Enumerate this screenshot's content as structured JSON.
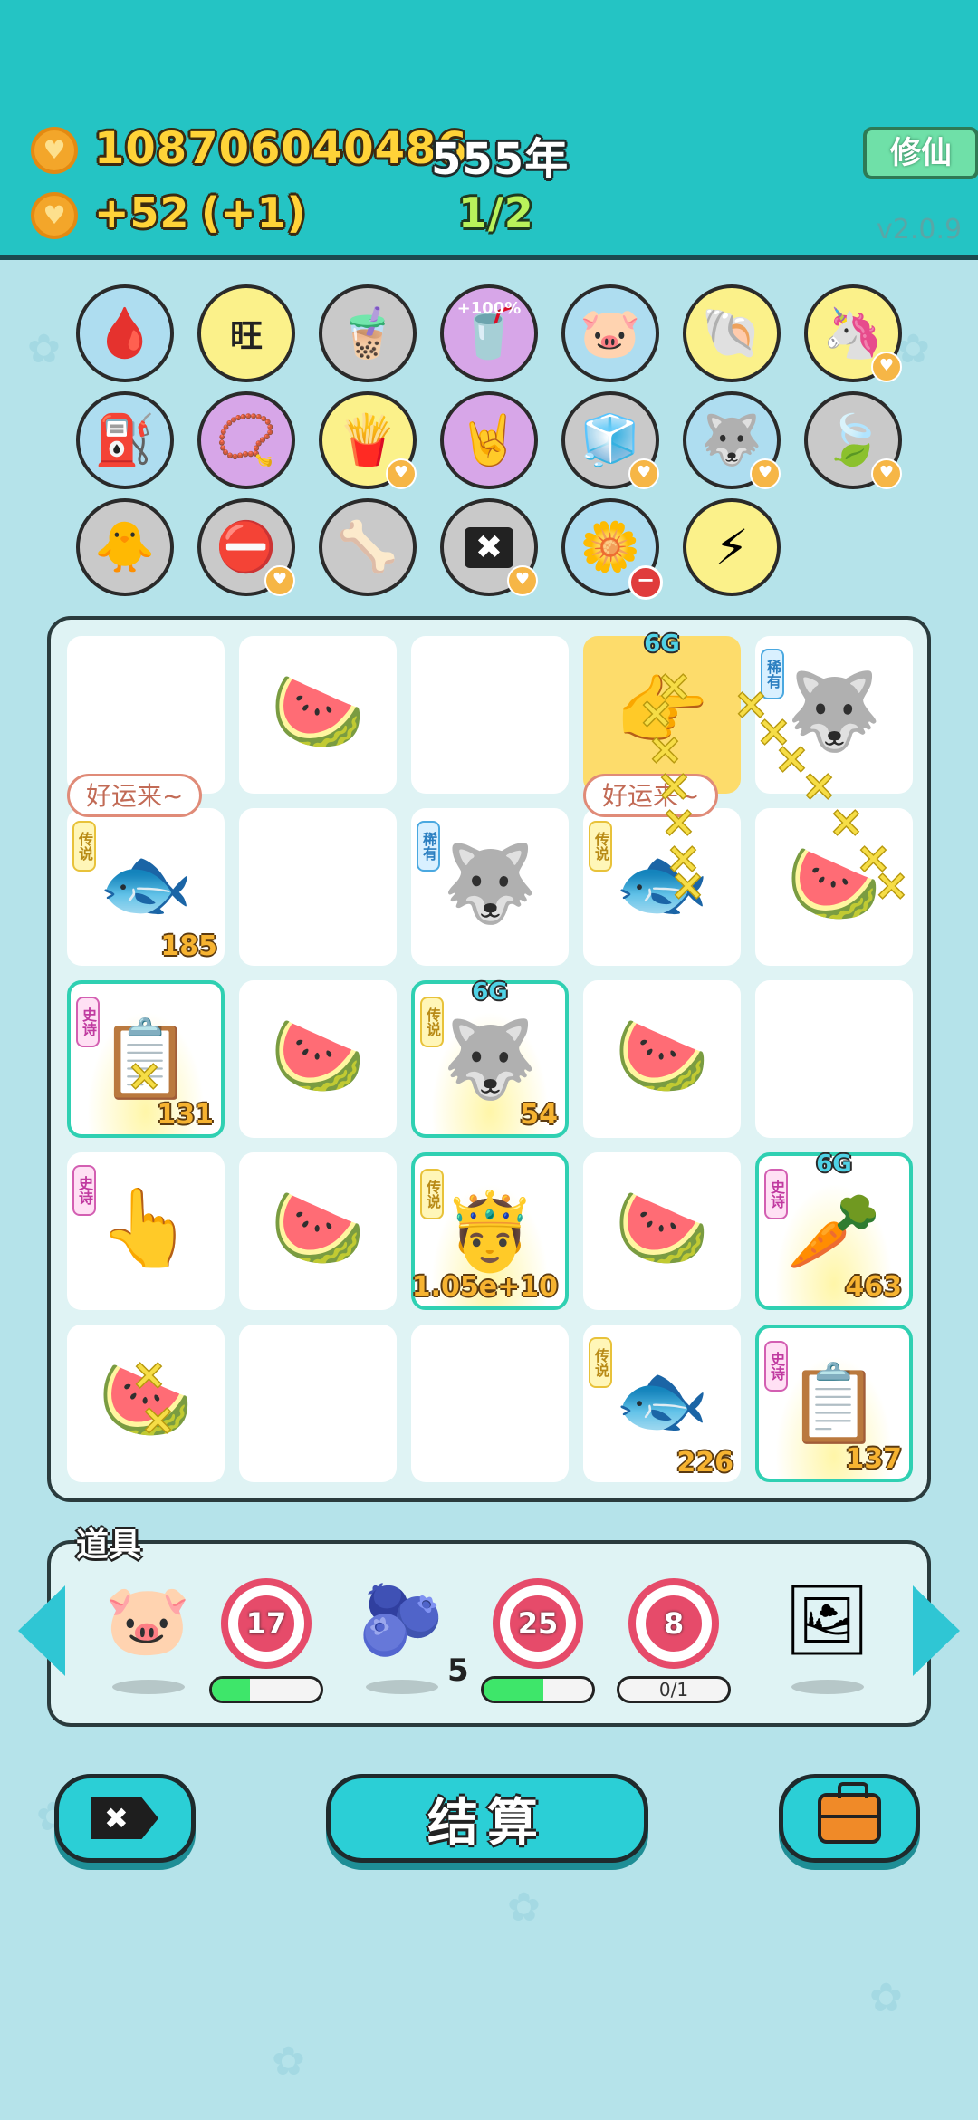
{
  "header": {
    "coins": "108706040486",
    "year": "555年",
    "income": "+52",
    "income_bonus": "(+1)",
    "progress": "1/2",
    "mode_button": "修仙",
    "version": "v2.0.9"
  },
  "relics": [
    {
      "name": "blood-bag-icon",
      "glyph": "🩸",
      "bg": "#aeddf0"
    },
    {
      "name": "wang-tiles-icon",
      "glyph": "旺",
      "bg": "#fbf18a"
    },
    {
      "name": "milk-tea-icon",
      "glyph": "🧋",
      "bg": "#c9c9c9"
    },
    {
      "name": "milk-tea-plus-icon",
      "glyph": "🥤",
      "bg": "#d7a6e8",
      "label": "+100%"
    },
    {
      "name": "piggy-bank-icon",
      "glyph": "🐷",
      "bg": "#aeddf0"
    },
    {
      "name": "shell-icon",
      "glyph": "🐚",
      "bg": "#fbf18a"
    },
    {
      "name": "unicorn-icon",
      "glyph": "🦄",
      "bg": "#fbf18a",
      "heart": true
    },
    {
      "name": "air-pump-icon",
      "glyph": "⛽",
      "bg": "#aeddf0"
    },
    {
      "name": "pendant-icon",
      "glyph": "📿",
      "bg": "#d7a6e8"
    },
    {
      "name": "fries-icon",
      "glyph": "🍟",
      "bg": "#fbf18a",
      "heart": true
    },
    {
      "name": "rock-hand-icon",
      "glyph": "🤘",
      "bg": "#d7a6e8"
    },
    {
      "name": "sugar-cubes-icon",
      "glyph": "🧊",
      "bg": "#c9c9c9",
      "heart": true
    },
    {
      "name": "husky-icon",
      "glyph": "🐺",
      "bg": "#aeddf0",
      "heart": true
    },
    {
      "name": "leaf-icon",
      "glyph": "🍃",
      "bg": "#c9c9c9",
      "heart": true
    },
    {
      "name": "chick-egg-icon",
      "glyph": "🐥",
      "bg": "#c9c9c9"
    },
    {
      "name": "no-entry-icon",
      "glyph": "⛔",
      "bg": "#c9c9c9",
      "heart": true
    },
    {
      "name": "dog-bowl-icon",
      "glyph": "🦴",
      "bg": "#c9c9c9"
    },
    {
      "name": "remove-tag-icon",
      "glyph": "✖",
      "bg": "#c9c9c9",
      "heart": true
    },
    {
      "name": "flower-pot-icon",
      "glyph": "🌼",
      "bg": "#aeddf0",
      "minus": true
    },
    {
      "name": "lightning-icon",
      "glyph": "⚡",
      "bg": "#fbf18a"
    }
  ],
  "board": {
    "cells": [
      {
        "name": "empty",
        "glyph": ""
      },
      {
        "name": "watermelon",
        "glyph": "🍉"
      },
      {
        "name": "empty",
        "glyph": ""
      },
      {
        "name": "golden-hand",
        "glyph": "👉",
        "g6": true,
        "highlight": true
      },
      {
        "name": "husky",
        "glyph": "🐺",
        "badge": "稀有",
        "badge_type": "xiyou"
      },
      {
        "name": "koi-fish",
        "glyph": "🐟",
        "badge": "传说",
        "badge_type": "chuanshuo",
        "count": "185"
      },
      {
        "name": "empty",
        "glyph": ""
      },
      {
        "name": "husky",
        "glyph": "🐺",
        "badge": "稀有",
        "badge_type": "xiyou"
      },
      {
        "name": "koi-fish",
        "glyph": "🐟",
        "badge": "传说",
        "badge_type": "chuanshuo"
      },
      {
        "name": "watermelon",
        "glyph": "🍉"
      },
      {
        "name": "copy-paste-king",
        "glyph": "📋",
        "badge": "史诗",
        "badge_type": "shishi",
        "count": "131",
        "golden": true
      },
      {
        "name": "watermelon",
        "glyph": "🍉"
      },
      {
        "name": "husky-king",
        "glyph": "🐺",
        "badge": "传说",
        "badge_type": "chuanshuo",
        "count": "54",
        "golden": true,
        "g6": true
      },
      {
        "name": "watermelon",
        "glyph": "🍉"
      },
      {
        "name": "empty",
        "glyph": ""
      },
      {
        "name": "pointing-hand",
        "glyph": "👆",
        "badge": "史诗",
        "badge_type": "shishi"
      },
      {
        "name": "watermelon",
        "glyph": "🍉"
      },
      {
        "name": "rich-grandpa-king",
        "glyph": "🤴",
        "badge": "传说",
        "badge_type": "chuanshuo",
        "count": "1.05e+10",
        "golden": true
      },
      {
        "name": "watermelon",
        "glyph": "🍉"
      },
      {
        "name": "carrot-king",
        "glyph": "🥕",
        "badge": "史诗",
        "badge_type": "shishi",
        "count": "463",
        "golden": true,
        "g6": true
      },
      {
        "name": "watermelon",
        "glyph": "🍉"
      },
      {
        "name": "empty",
        "glyph": ""
      },
      {
        "name": "empty",
        "glyph": ""
      },
      {
        "name": "koi-fish",
        "glyph": "🐟",
        "badge": "传说",
        "badge_type": "chuanshuo",
        "count": "226"
      },
      {
        "name": "copy-paste-king",
        "glyph": "📋",
        "badge": "史诗",
        "badge_type": "shishi",
        "count": "137",
        "golden": true
      }
    ],
    "bubbles": [
      "好运来~",
      "好运来~"
    ],
    "g6_label": "6G"
  },
  "props": {
    "label": "道具",
    "items": [
      {
        "name": "piggy-bank",
        "glyph": "🐷"
      },
      {
        "name": "target-17",
        "value": "17",
        "progress": 0.35
      },
      {
        "name": "blueberry",
        "glyph": "🫐",
        "count": "5"
      },
      {
        "name": "target-25",
        "value": "25",
        "progress": 0.55
      },
      {
        "name": "target-8",
        "value": "8",
        "progress_text": "0/1"
      },
      {
        "name": "wooden-frame",
        "glyph": "🖼"
      }
    ]
  },
  "buttons": {
    "remove_glyph": "✖",
    "settle": "结算"
  },
  "colors": {
    "header_bg": "#24c4c4",
    "page_bg": "#b5e3ea",
    "accent": "#2bcfd6",
    "gold_text": "#ffd338",
    "count_text": "#f6b331"
  }
}
